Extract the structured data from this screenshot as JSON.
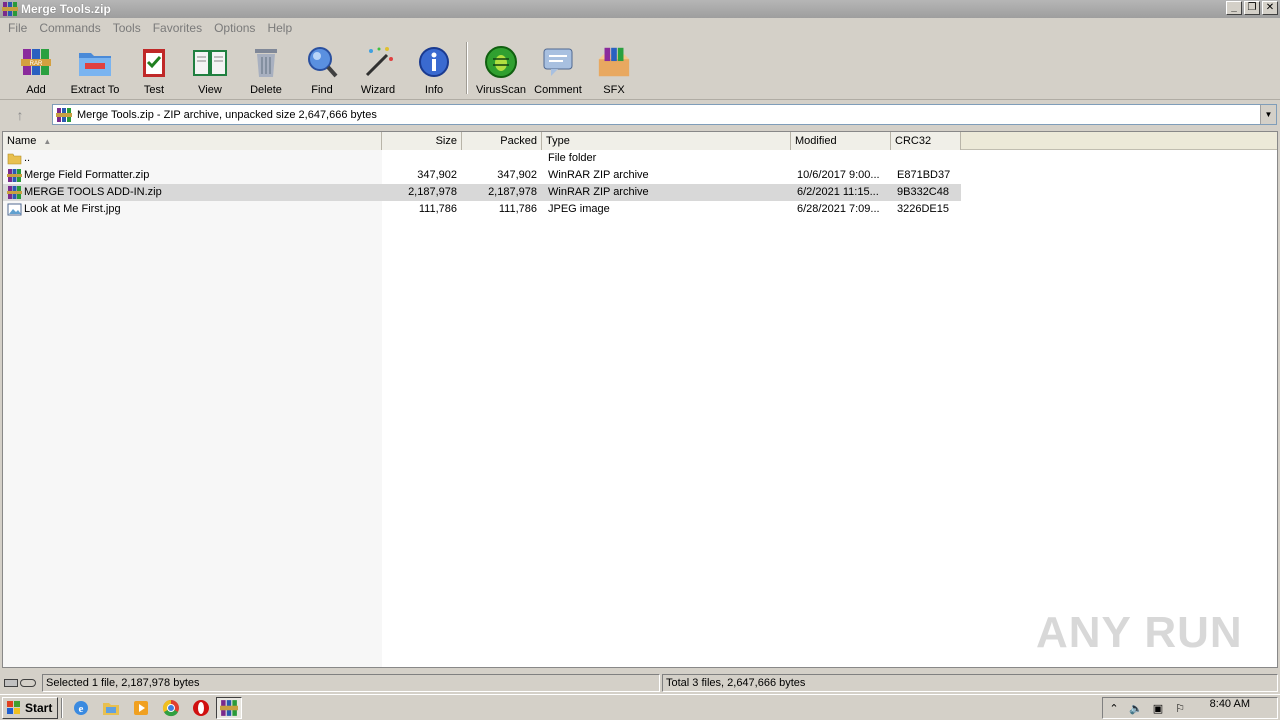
{
  "window": {
    "title": "Merge Tools.zip"
  },
  "menu": [
    "File",
    "Commands",
    "Tools",
    "Favorites",
    "Options",
    "Help"
  ],
  "toolbar": {
    "add": "Add",
    "extract_to": "Extract To",
    "test": "Test",
    "view": "View",
    "delete": "Delete",
    "find": "Find",
    "wizard": "Wizard",
    "info": "Info",
    "virusscan": "VirusScan",
    "comment": "Comment",
    "sfx": "SFX"
  },
  "address": {
    "text": "Merge Tools.zip - ZIP archive, unpacked size 2,647,666 bytes"
  },
  "columns": {
    "name": "Name",
    "size": "Size",
    "packed": "Packed",
    "type": "Type",
    "modified": "Modified",
    "crc32": "CRC32"
  },
  "files": [
    {
      "name": "..",
      "size": "",
      "packed": "",
      "type": "File folder",
      "modified": "",
      "crc": "",
      "icon": "folder-icon"
    },
    {
      "name": "Merge Field Formatter.zip",
      "size": "347,902",
      "packed": "347,902",
      "type": "WinRAR ZIP archive",
      "modified": "10/6/2017 9:00...",
      "crc": "E871BD37",
      "icon": "winrar-zip-icon"
    },
    {
      "name": "MERGE TOOLS ADD-IN.zip",
      "size": "2,187,978",
      "packed": "2,187,978",
      "type": "WinRAR ZIP archive",
      "modified": "6/2/2021 11:15...",
      "crc": "9B332C48",
      "icon": "winrar-zip-icon",
      "selected": true
    },
    {
      "name": "Look at Me First.jpg",
      "size": "111,786",
      "packed": "111,786",
      "type": "JPEG image",
      "modified": "6/28/2021 7:09...",
      "crc": "3226DE15",
      "icon": "image-file-icon"
    }
  ],
  "status": {
    "left": "Selected 1 file, 2,187,978 bytes",
    "right": "Total 3 files, 2,647,666 bytes"
  },
  "taskbar": {
    "start": "Start",
    "clock": "8:40 AM"
  },
  "watermark": "ANY RUN"
}
